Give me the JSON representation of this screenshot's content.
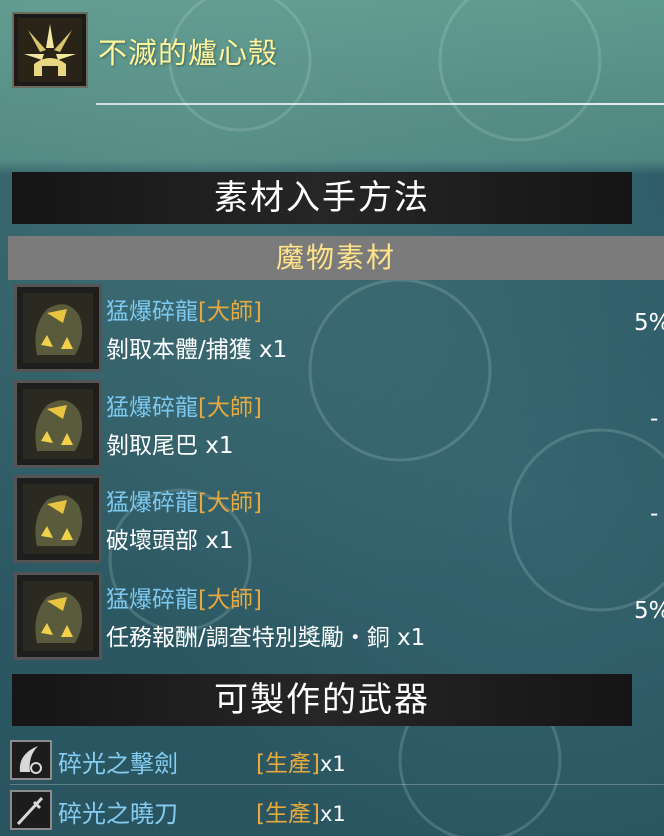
{
  "item": {
    "name": "不滅的爐心殼",
    "icon": "item-shell-icon"
  },
  "acquisition": {
    "title": "素材入手方法",
    "category": "魔物素材",
    "rows": [
      {
        "monster": "猛爆碎龍",
        "rank": "[大師]",
        "method": "剝取本體/捕獲 x1",
        "rate": "5%",
        "icon": "brachydios-icon"
      },
      {
        "monster": "猛爆碎龍",
        "rank": "[大師]",
        "method": "剝取尾巴 x1",
        "rate": "-",
        "icon": "brachydios-icon"
      },
      {
        "monster": "猛爆碎龍",
        "rank": "[大師]",
        "method": "破壞頭部 x1",
        "rate": "-",
        "icon": "brachydios-icon"
      },
      {
        "monster": "猛爆碎龍",
        "rank": "[大師]",
        "method": "任務報酬/調查特別獎勵・銅 x1",
        "rate": "5%",
        "icon": "brachydios-icon"
      }
    ]
  },
  "weapons": {
    "title": "可製作的武器",
    "rows": [
      {
        "name": "碎光之擊劍",
        "source": "[生產]",
        "qty": "x1",
        "icon": "great-sword-icon"
      },
      {
        "name": "碎光之曉刀",
        "source": "[生產]",
        "qty": "x1",
        "icon": "long-sword-icon"
      }
    ]
  },
  "colors": {
    "item_name": "#fff59a",
    "monster": "#7ec8f0",
    "rank": "#e6a93c",
    "category": "#ffe38a"
  }
}
